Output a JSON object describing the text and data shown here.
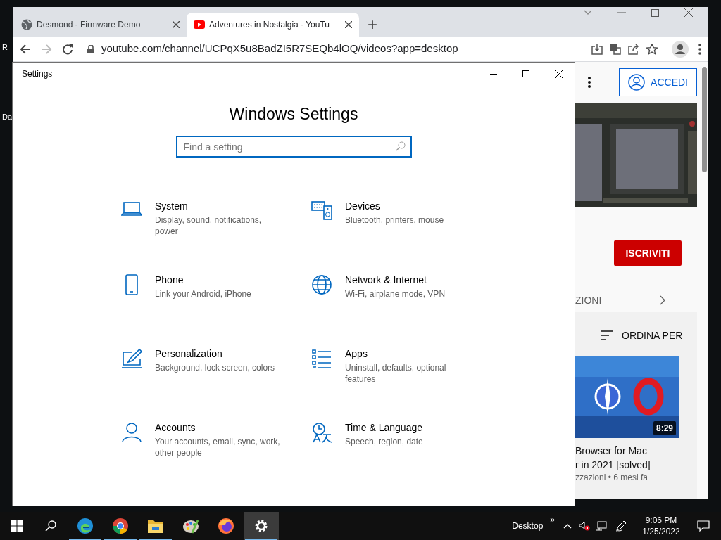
{
  "desktop": {
    "icon_labels": [
      "R",
      "Da"
    ]
  },
  "browser": {
    "tabs": [
      {
        "kind": "globe",
        "title": "Desmond - Firmware Demo",
        "selected": false
      },
      {
        "kind": "youtube",
        "title": "Adventures in Nostalgia - YouTu",
        "selected": true
      }
    ],
    "new_tab": "+",
    "address": "youtube.com/channel/UCPqX5u8BadZI5R7SEQb4lOQ/videos?app=desktop"
  },
  "page": {
    "sign_in": "ACCEDI",
    "subscribe": "ISCRIVITI",
    "tab_fragment": "ZIONI",
    "sort": "ORDINA PER",
    "video": {
      "duration": "8:29",
      "title_lines": [
        "Browser for Mac",
        "r in 2021 [solved]"
      ],
      "meta": "zzazioni • 6 mesi fa"
    }
  },
  "settings": {
    "window_title": "Settings",
    "heading": "Windows Settings",
    "search": {
      "placeholder": "Find a setting"
    },
    "items": [
      {
        "kind": "system",
        "title": "System",
        "description": "Display, sound, notifications, power"
      },
      {
        "kind": "devices",
        "title": "Devices",
        "description": "Bluetooth, printers, mouse"
      },
      {
        "kind": "phone",
        "title": "Phone",
        "description": "Link your Android, iPhone"
      },
      {
        "kind": "network",
        "title": "Network & Internet",
        "description": "Wi-Fi, airplane mode, VPN"
      },
      {
        "kind": "personalization",
        "title": "Personalization",
        "description": "Background, lock screen, colors"
      },
      {
        "kind": "apps",
        "title": "Apps",
        "description": "Uninstall, defaults, optional features"
      },
      {
        "kind": "accounts",
        "title": "Accounts",
        "description": "Your accounts, email, sync, work, other people"
      },
      {
        "kind": "time",
        "title": "Time & Language",
        "description": "Speech, region, date"
      }
    ]
  },
  "taskbar": {
    "apps": [
      {
        "kind": "edge",
        "running": true,
        "active": false
      },
      {
        "kind": "chrome",
        "running": true,
        "active": false
      },
      {
        "kind": "explorer",
        "running": true,
        "active": false
      },
      {
        "kind": "paint",
        "running": false,
        "active": false
      },
      {
        "kind": "firefox",
        "running": false,
        "active": false
      },
      {
        "kind": "settings",
        "running": true,
        "active": true
      }
    ],
    "toolbar_label": "Desktop",
    "overflow": "»",
    "time": "9:06 PM",
    "date": "1/25/2022"
  }
}
